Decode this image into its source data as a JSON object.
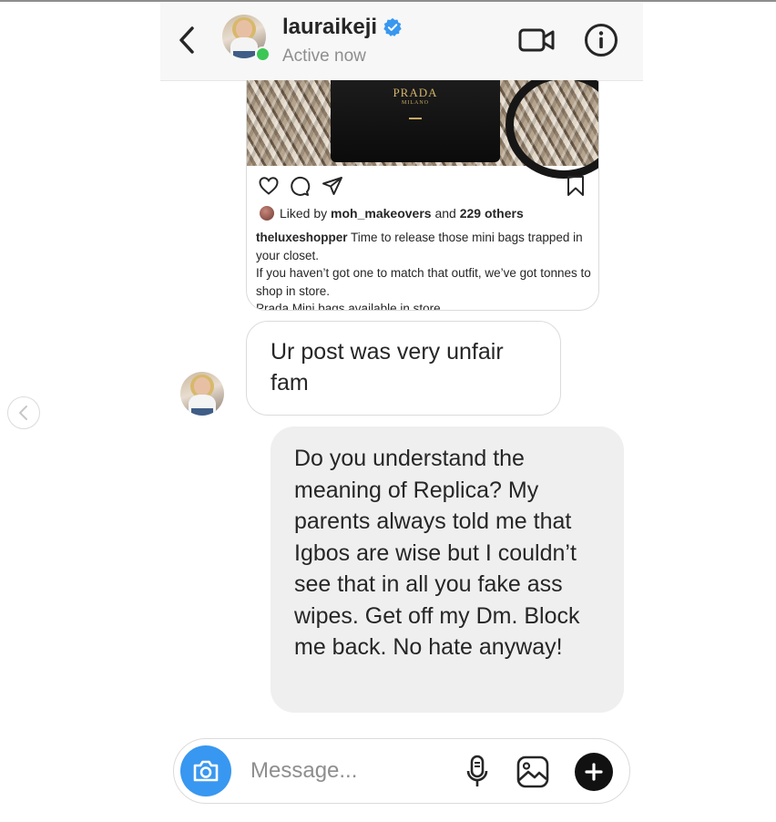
{
  "header": {
    "username": "lauraikeji",
    "status": "Active now",
    "verified_icon": "verified-badge-icon",
    "back_icon": "chevron-left-icon",
    "video_icon": "video-camera-icon",
    "info_icon": "info-icon"
  },
  "shared_post": {
    "image_brand": "PRADA",
    "image_brand_sub": "MILANO",
    "liked_prefix": "Liked by ",
    "liked_user": "moh_makeovers",
    "liked_and": " and ",
    "liked_others": "229 others",
    "caption_user": "theluxeshopper",
    "caption_text": "Time to release those mini bags trapped in your closet.",
    "caption_line2": "If you haven’t got one to match that outfit, we’ve got tonnes to shop in store.",
    "caption_line3": "Prada Mini bags available in store"
  },
  "messages": {
    "received_text": "Ur post was very unfair fam",
    "sent_text": "Do you understand the meaning of Replica? My parents always told me that Igbos are wise but I couldn’t see that in all you fake ass wipes. Get off my Dm. Block me back. No hate anyway!"
  },
  "composer": {
    "placeholder": "Message...",
    "camera_icon": "camera-icon",
    "mic_icon": "microphone-icon",
    "gallery_icon": "gallery-icon",
    "plus_icon": "plus-icon"
  },
  "colors": {
    "accent_blue": "#3897f0",
    "online_green": "#3cc654",
    "bubble_sent": "#efefef",
    "border": "#dbdbdb"
  }
}
